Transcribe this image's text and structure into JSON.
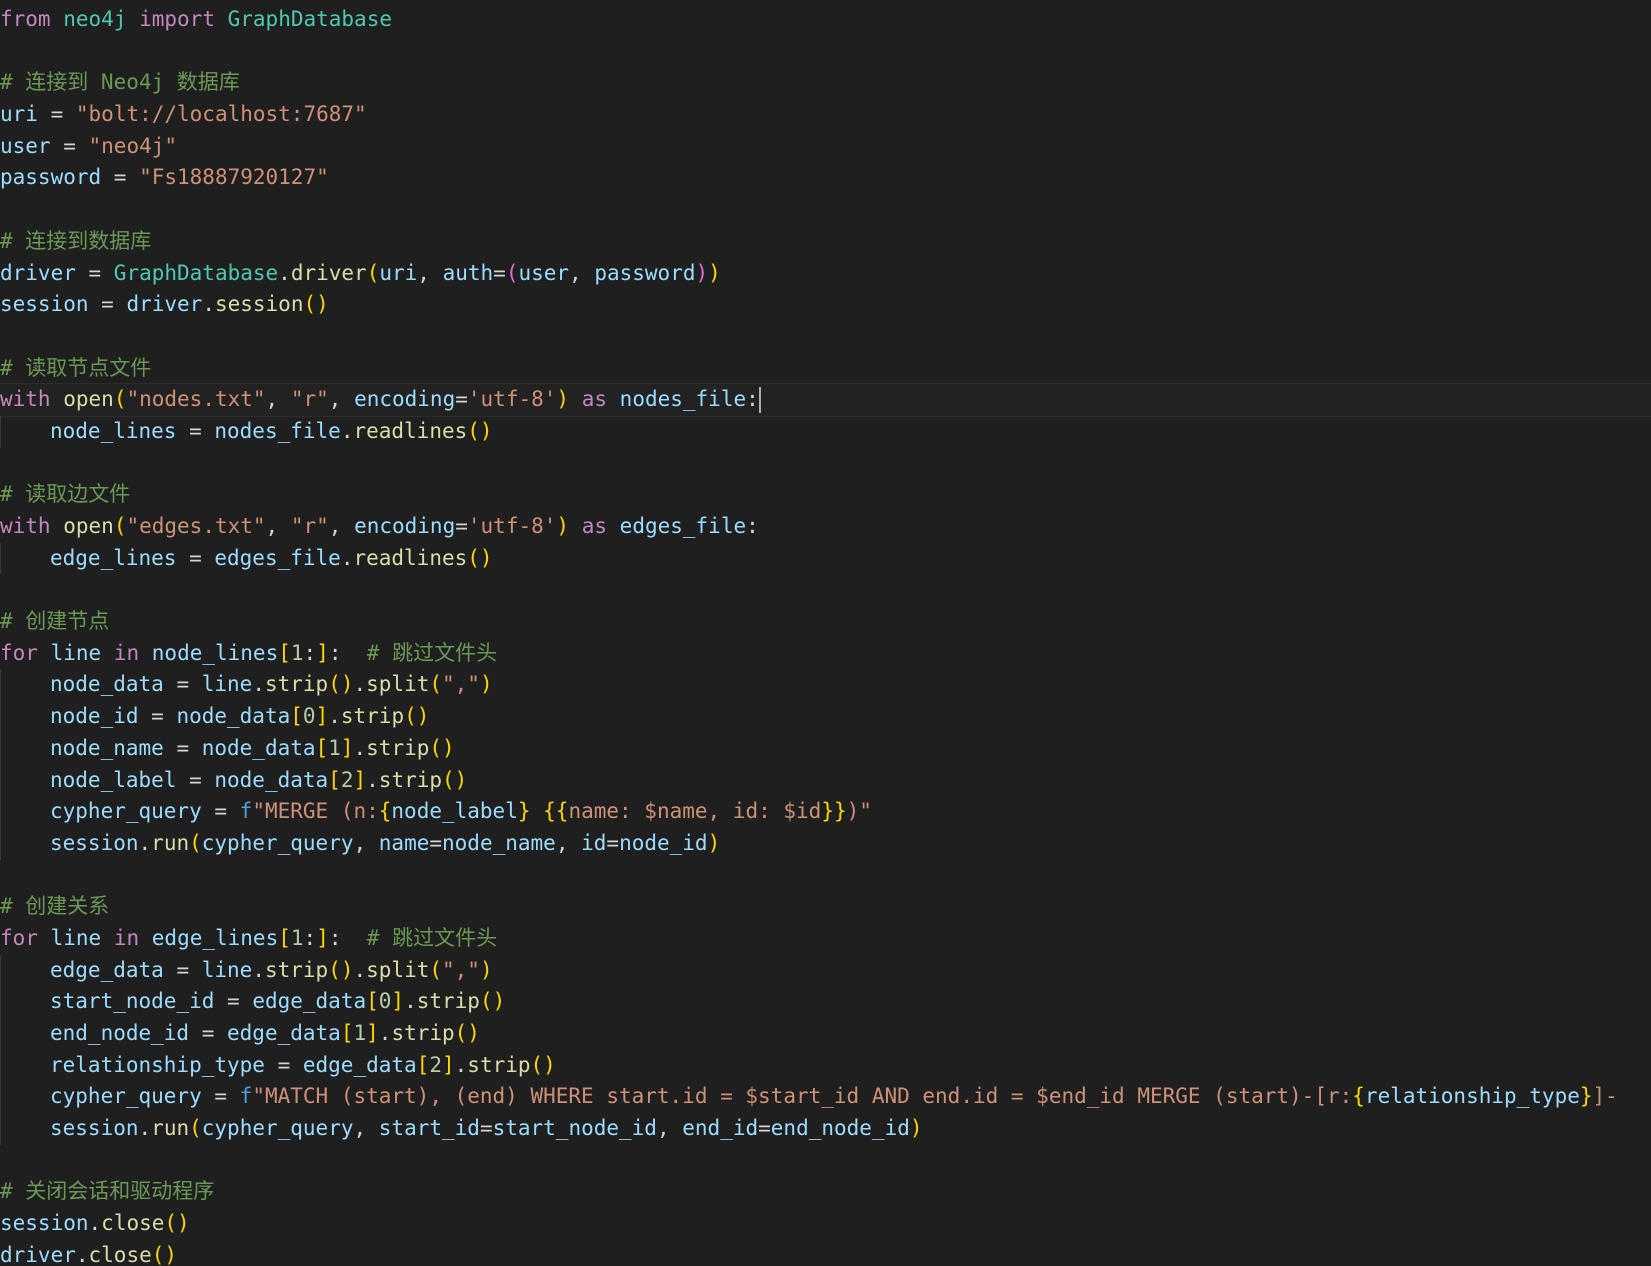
{
  "editor": {
    "language": "python",
    "colors": {
      "background": "#1f1f1f",
      "keyword": "#c586c0",
      "function": "#dcdcaa",
      "variable": "#9cdcfe",
      "class": "#4ec9b0",
      "string": "#ce9178",
      "comment": "#6a9955",
      "number": "#b5cea8",
      "bracket_level1": "#ffd700",
      "bracket_level2": "#da70d6"
    },
    "lines": [
      {
        "indent": 0,
        "tokens": [
          [
            "kw",
            "from"
          ],
          [
            "pun",
            " "
          ],
          [
            "cls",
            "neo4j"
          ],
          [
            "pun",
            " "
          ],
          [
            "kw",
            "import"
          ],
          [
            "pun",
            " "
          ],
          [
            "cls",
            "GraphDatabase"
          ]
        ]
      },
      {
        "indent": 0,
        "tokens": []
      },
      {
        "indent": 0,
        "tokens": [
          [
            "com",
            "# 连接到 Neo4j 数据库"
          ]
        ]
      },
      {
        "indent": 0,
        "tokens": [
          [
            "var",
            "uri"
          ],
          [
            "pun",
            " = "
          ],
          [
            "str",
            "\"bolt://localhost:7687\""
          ]
        ]
      },
      {
        "indent": 0,
        "tokens": [
          [
            "var",
            "user"
          ],
          [
            "pun",
            " = "
          ],
          [
            "str",
            "\"neo4j\""
          ]
        ]
      },
      {
        "indent": 0,
        "tokens": [
          [
            "var",
            "password"
          ],
          [
            "pun",
            " = "
          ],
          [
            "str",
            "\"Fs18887920127\""
          ]
        ]
      },
      {
        "indent": 0,
        "tokens": []
      },
      {
        "indent": 0,
        "tokens": [
          [
            "com",
            "# 连接到数据库"
          ]
        ]
      },
      {
        "indent": 0,
        "tokens": [
          [
            "var",
            "driver"
          ],
          [
            "pun",
            " = "
          ],
          [
            "cls",
            "GraphDatabase"
          ],
          [
            "pun",
            "."
          ],
          [
            "fn",
            "driver"
          ],
          [
            "br1",
            "("
          ],
          [
            "var",
            "uri"
          ],
          [
            "pun",
            ", "
          ],
          [
            "var",
            "auth"
          ],
          [
            "pun",
            "="
          ],
          [
            "br2",
            "("
          ],
          [
            "var",
            "user"
          ],
          [
            "pun",
            ", "
          ],
          [
            "var",
            "password"
          ],
          [
            "br2",
            ")"
          ],
          [
            "br1",
            ")"
          ]
        ]
      },
      {
        "indent": 0,
        "tokens": [
          [
            "var",
            "session"
          ],
          [
            "pun",
            " = "
          ],
          [
            "var",
            "driver"
          ],
          [
            "pun",
            "."
          ],
          [
            "fn",
            "session"
          ],
          [
            "br1",
            "()"
          ]
        ]
      },
      {
        "indent": 0,
        "tokens": []
      },
      {
        "indent": 0,
        "tokens": [
          [
            "com",
            "# 读取节点文件"
          ]
        ]
      },
      {
        "indent": 0,
        "current": true,
        "tokens": [
          [
            "kw",
            "with"
          ],
          [
            "pun",
            " "
          ],
          [
            "fn",
            "open"
          ],
          [
            "br1",
            "("
          ],
          [
            "str",
            "\"nodes.txt\""
          ],
          [
            "pun",
            ", "
          ],
          [
            "str",
            "\"r\""
          ],
          [
            "pun",
            ", "
          ],
          [
            "var",
            "encoding"
          ],
          [
            "pun",
            "="
          ],
          [
            "str",
            "'utf-8'"
          ],
          [
            "br1",
            ")"
          ],
          [
            "pun",
            " "
          ],
          [
            "kw",
            "as"
          ],
          [
            "pun",
            " "
          ],
          [
            "var",
            "nodes_file"
          ],
          [
            "pun",
            ":"
          ]
        ]
      },
      {
        "indent": 1,
        "tokens": [
          [
            "var",
            "node_lines"
          ],
          [
            "pun",
            " = "
          ],
          [
            "var",
            "nodes_file"
          ],
          [
            "pun",
            "."
          ],
          [
            "fn",
            "readlines"
          ],
          [
            "br1",
            "()"
          ]
        ]
      },
      {
        "indent": 0,
        "tokens": []
      },
      {
        "indent": 0,
        "tokens": [
          [
            "com",
            "# 读取边文件"
          ]
        ]
      },
      {
        "indent": 0,
        "tokens": [
          [
            "kw",
            "with"
          ],
          [
            "pun",
            " "
          ],
          [
            "fn",
            "open"
          ],
          [
            "br1",
            "("
          ],
          [
            "str",
            "\"edges.txt\""
          ],
          [
            "pun",
            ", "
          ],
          [
            "str",
            "\"r\""
          ],
          [
            "pun",
            ", "
          ],
          [
            "var",
            "encoding"
          ],
          [
            "pun",
            "="
          ],
          [
            "str",
            "'utf-8'"
          ],
          [
            "br1",
            ")"
          ],
          [
            "pun",
            " "
          ],
          [
            "kw",
            "as"
          ],
          [
            "pun",
            " "
          ],
          [
            "var",
            "edges_file"
          ],
          [
            "pun",
            ":"
          ]
        ]
      },
      {
        "indent": 1,
        "tokens": [
          [
            "var",
            "edge_lines"
          ],
          [
            "pun",
            " = "
          ],
          [
            "var",
            "edges_file"
          ],
          [
            "pun",
            "."
          ],
          [
            "fn",
            "readlines"
          ],
          [
            "br1",
            "()"
          ]
        ]
      },
      {
        "indent": 0,
        "tokens": []
      },
      {
        "indent": 0,
        "tokens": [
          [
            "com",
            "# 创建节点"
          ]
        ]
      },
      {
        "indent": 0,
        "tokens": [
          [
            "kw",
            "for"
          ],
          [
            "pun",
            " "
          ],
          [
            "var",
            "line"
          ],
          [
            "pun",
            " "
          ],
          [
            "kw",
            "in"
          ],
          [
            "pun",
            " "
          ],
          [
            "var",
            "node_lines"
          ],
          [
            "br1",
            "["
          ],
          [
            "num",
            "1"
          ],
          [
            "pun",
            ":"
          ],
          [
            "br1",
            "]"
          ],
          [
            "pun",
            ":  "
          ],
          [
            "com",
            "# 跳过文件头"
          ]
        ]
      },
      {
        "indent": 1,
        "tokens": [
          [
            "var",
            "node_data"
          ],
          [
            "pun",
            " = "
          ],
          [
            "var",
            "line"
          ],
          [
            "pun",
            "."
          ],
          [
            "fn",
            "strip"
          ],
          [
            "br1",
            "()"
          ],
          [
            "pun",
            "."
          ],
          [
            "fn",
            "split"
          ],
          [
            "br1",
            "("
          ],
          [
            "str",
            "\",\""
          ],
          [
            "br1",
            ")"
          ]
        ]
      },
      {
        "indent": 1,
        "tokens": [
          [
            "var",
            "node_id"
          ],
          [
            "pun",
            " = "
          ],
          [
            "var",
            "node_data"
          ],
          [
            "br1",
            "["
          ],
          [
            "num",
            "0"
          ],
          [
            "br1",
            "]"
          ],
          [
            "pun",
            "."
          ],
          [
            "fn",
            "strip"
          ],
          [
            "br1",
            "()"
          ]
        ]
      },
      {
        "indent": 1,
        "tokens": [
          [
            "var",
            "node_name"
          ],
          [
            "pun",
            " = "
          ],
          [
            "var",
            "node_data"
          ],
          [
            "br1",
            "["
          ],
          [
            "num",
            "1"
          ],
          [
            "br1",
            "]"
          ],
          [
            "pun",
            "."
          ],
          [
            "fn",
            "strip"
          ],
          [
            "br1",
            "()"
          ]
        ]
      },
      {
        "indent": 1,
        "tokens": [
          [
            "var",
            "node_label"
          ],
          [
            "pun",
            " = "
          ],
          [
            "var",
            "node_data"
          ],
          [
            "br1",
            "["
          ],
          [
            "num",
            "2"
          ],
          [
            "br1",
            "]"
          ],
          [
            "pun",
            "."
          ],
          [
            "fn",
            "strip"
          ],
          [
            "br1",
            "()"
          ]
        ]
      },
      {
        "indent": 1,
        "tokens": [
          [
            "var",
            "cypher_query"
          ],
          [
            "pun",
            " = "
          ],
          [
            "fpre",
            "f"
          ],
          [
            "str",
            "\"MERGE (n:"
          ],
          [
            "br1",
            "{"
          ],
          [
            "var",
            "node_label"
          ],
          [
            "br1",
            "}"
          ],
          [
            "str",
            " "
          ],
          [
            "br1",
            "{{"
          ],
          [
            "str",
            "name: $name, id: $id"
          ],
          [
            "br1",
            "}}"
          ],
          [
            "str",
            ")\""
          ]
        ]
      },
      {
        "indent": 1,
        "tokens": [
          [
            "var",
            "session"
          ],
          [
            "pun",
            "."
          ],
          [
            "fn",
            "run"
          ],
          [
            "br1",
            "("
          ],
          [
            "var",
            "cypher_query"
          ],
          [
            "pun",
            ", "
          ],
          [
            "var",
            "name"
          ],
          [
            "pun",
            "="
          ],
          [
            "var",
            "node_name"
          ],
          [
            "pun",
            ", "
          ],
          [
            "var",
            "id"
          ],
          [
            "pun",
            "="
          ],
          [
            "var",
            "node_id"
          ],
          [
            "br1",
            ")"
          ]
        ]
      },
      {
        "indent": 0,
        "tokens": []
      },
      {
        "indent": 0,
        "tokens": [
          [
            "com",
            "# 创建关系"
          ]
        ]
      },
      {
        "indent": 0,
        "tokens": [
          [
            "kw",
            "for"
          ],
          [
            "pun",
            " "
          ],
          [
            "var",
            "line"
          ],
          [
            "pun",
            " "
          ],
          [
            "kw",
            "in"
          ],
          [
            "pun",
            " "
          ],
          [
            "var",
            "edge_lines"
          ],
          [
            "br1",
            "["
          ],
          [
            "num",
            "1"
          ],
          [
            "pun",
            ":"
          ],
          [
            "br1",
            "]"
          ],
          [
            "pun",
            ":  "
          ],
          [
            "com",
            "# 跳过文件头"
          ]
        ]
      },
      {
        "indent": 1,
        "tokens": [
          [
            "var",
            "edge_data"
          ],
          [
            "pun",
            " = "
          ],
          [
            "var",
            "line"
          ],
          [
            "pun",
            "."
          ],
          [
            "fn",
            "strip"
          ],
          [
            "br1",
            "()"
          ],
          [
            "pun",
            "."
          ],
          [
            "fn",
            "split"
          ],
          [
            "br1",
            "("
          ],
          [
            "str",
            "\",\""
          ],
          [
            "br1",
            ")"
          ]
        ]
      },
      {
        "indent": 1,
        "tokens": [
          [
            "var",
            "start_node_id"
          ],
          [
            "pun",
            " = "
          ],
          [
            "var",
            "edge_data"
          ],
          [
            "br1",
            "["
          ],
          [
            "num",
            "0"
          ],
          [
            "br1",
            "]"
          ],
          [
            "pun",
            "."
          ],
          [
            "fn",
            "strip"
          ],
          [
            "br1",
            "()"
          ]
        ]
      },
      {
        "indent": 1,
        "tokens": [
          [
            "var",
            "end_node_id"
          ],
          [
            "pun",
            " = "
          ],
          [
            "var",
            "edge_data"
          ],
          [
            "br1",
            "["
          ],
          [
            "num",
            "1"
          ],
          [
            "br1",
            "]"
          ],
          [
            "pun",
            "."
          ],
          [
            "fn",
            "strip"
          ],
          [
            "br1",
            "()"
          ]
        ]
      },
      {
        "indent": 1,
        "tokens": [
          [
            "var",
            "relationship_type"
          ],
          [
            "pun",
            " = "
          ],
          [
            "var",
            "edge_data"
          ],
          [
            "br1",
            "["
          ],
          [
            "num",
            "2"
          ],
          [
            "br1",
            "]"
          ],
          [
            "pun",
            "."
          ],
          [
            "fn",
            "strip"
          ],
          [
            "br1",
            "()"
          ]
        ]
      },
      {
        "indent": 1,
        "tokens": [
          [
            "var",
            "cypher_query"
          ],
          [
            "pun",
            " = "
          ],
          [
            "fpre",
            "f"
          ],
          [
            "str",
            "\"MATCH (start), (end) WHERE start.id = $start_id AND end.id = $end_id MERGE (start)-[r:"
          ],
          [
            "br1",
            "{"
          ],
          [
            "var",
            "relationship_type"
          ],
          [
            "br1",
            "}"
          ],
          [
            "str",
            "]-"
          ]
        ]
      },
      {
        "indent": 1,
        "tokens": [
          [
            "var",
            "session"
          ],
          [
            "pun",
            "."
          ],
          [
            "fn",
            "run"
          ],
          [
            "br1",
            "("
          ],
          [
            "var",
            "cypher_query"
          ],
          [
            "pun",
            ", "
          ],
          [
            "var",
            "start_id"
          ],
          [
            "pun",
            "="
          ],
          [
            "var",
            "start_node_id"
          ],
          [
            "pun",
            ", "
          ],
          [
            "var",
            "end_id"
          ],
          [
            "pun",
            "="
          ],
          [
            "var",
            "end_node_id"
          ],
          [
            "br1",
            ")"
          ]
        ]
      },
      {
        "indent": 0,
        "tokens": []
      },
      {
        "indent": 0,
        "tokens": [
          [
            "com",
            "# 关闭会话和驱动程序"
          ]
        ]
      },
      {
        "indent": 0,
        "tokens": [
          [
            "var",
            "session"
          ],
          [
            "pun",
            "."
          ],
          [
            "fn",
            "close"
          ],
          [
            "br1",
            "()"
          ]
        ]
      },
      {
        "indent": 0,
        "tokens": [
          [
            "var",
            "driver"
          ],
          [
            "pun",
            "."
          ],
          [
            "fn",
            "close"
          ],
          [
            "br1",
            "()"
          ]
        ]
      }
    ]
  }
}
